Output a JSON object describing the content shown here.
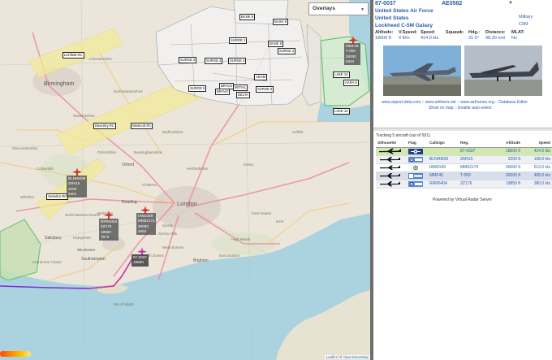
{
  "map": {
    "overlays_label": "Overlays",
    "attribution": {
      "leaflet": "Leaflet",
      "sep": "| ©",
      "osm": "OpenStreetMap"
    },
    "cities": {
      "birmingham": "Birmingham",
      "london": "London",
      "oxford": "Oxford",
      "southampton": "Southampton",
      "brighton": "Brighton",
      "salisbury": "Salisbury",
      "winchester": "Winchester",
      "reading": "Reading"
    },
    "region_labels": [
      "Cotswolds",
      "North Wessex Downs",
      "Chilterns",
      "Surrey Hills",
      "High Weald",
      "South Downs",
      "Kent Downs",
      "Cranborne Chase",
      "Isle of Wight",
      "Northamptonshire",
      "Leicestershire",
      "Warwickshire",
      "Bedfordshire",
      "Hertfordshire",
      "Essex",
      "Kent",
      "Hampshire",
      "Berkshire",
      "Wiltshire",
      "Gloucestershire",
      "Oxfordshire",
      "Buckinghamshire",
      "Suffolk",
      "East Sussex",
      "West Sussex",
      "Surrey"
    ],
    "airspace_labels": {
      "bank8a": "BANK 8",
      "bank8b": "BASH 8",
      "bank8c": "BANK 8",
      "surge1": "SURGE 1",
      "surge2": "SURGE 2",
      "surge2b": "SURGE 2",
      "surge3": "SURGE 3",
      "surge4": "SURGE 4",
      "surge5": "SURGE 5",
      "surge6": "SURGE 6",
      "bravo": "BRAVO",
      "bravo2": "BRAVO",
      "initial": "INITIAL",
      "delta": "DELTA",
      "adam": "ADAM",
      "lake12": "LAKE 12",
      "lake14": "LAKE 14",
      "aara9": "AARA 9",
      "lichfield": "Lichfield RC",
      "daventry": "Daventry RC",
      "westcott": "Westcott RC",
      "swindon": "Swindon RC"
    },
    "aircraft": [
      {
        "id": "BLNHM39",
        "lines": [
          "BLNHM39",
          "ZM415",
          "2200",
          "6401"
        ]
      },
      {
        "id": "RRR6404",
        "lines": [
          "RRR6404",
          "ZZ176",
          "18850",
          "7573"
        ]
      },
      {
        "id": "IAM3169",
        "lines": [
          "IAM3169",
          "MM62174",
          "36000",
          "2064"
        ]
      },
      {
        "id": "MMF45",
        "lines": [
          "MMF45",
          "T-059",
          "36000",
          "6344"
        ]
      },
      {
        "id": "87-0037",
        "lines": [
          "87-0037",
          "18600"
        ]
      }
    ]
  },
  "detail": {
    "registration": "87-0037",
    "icao": "AE0582",
    "operator": "United States Air Force",
    "country": "United States",
    "type": "Lockheed C-5M Galaxy",
    "category": "Military",
    "type_code": "C5M",
    "fields": [
      {
        "label": "Altitude:",
        "value": "18600 ft"
      },
      {
        "label": "V.Speed:",
        "value": "0 ft/m"
      },
      {
        "label": "Speed:",
        "value": "414.0 kts"
      },
      {
        "label": "Squawk:",
        "value": ""
      },
      {
        "label": "Hdg.:",
        "value": "31.0°"
      },
      {
        "label": "Distance:",
        "value": "98.30 nmi"
      },
      {
        "label": "MLAT:",
        "value": "No"
      }
    ],
    "links_line1": "www.airport-data.com :: www.airliners.net :: www.airframes.org :: Database Editor",
    "links_line2": "Show on map :: Enable auto-select"
  },
  "list": {
    "tracking_text": "Tracking 5 aircraft (out of 931).",
    "columns": [
      "Silhouette",
      "Flag",
      "Callsign",
      "Reg.",
      "Altitude",
      "Speed"
    ],
    "rows": [
      {
        "callsign": "",
        "reg": "87-0037",
        "altitude": "18600 ft",
        "speed": "414.0 kts",
        "flag": "usaf"
      },
      {
        "callsign": "BLNHM39",
        "reg": "ZM415",
        "altitude": "2200 ft",
        "speed": "108.0 kts",
        "flag": "raf"
      },
      {
        "callsign": "IAM3169",
        "reg": "MM62174",
        "altitude": "36000 ft",
        "speed": "513.0 kts",
        "flag": "ami"
      },
      {
        "callsign": "MMF45",
        "reg": "T-059",
        "altitude": "36000 ft",
        "speed": "408.0 kts",
        "flag": "mil"
      },
      {
        "callsign": "RRR6404",
        "reg": "ZZ176",
        "altitude": "19850 ft",
        "speed": "380.0 kts",
        "flag": "raf"
      }
    ],
    "powered_by": "Powered by Virtual Radar Server"
  },
  "colors": {
    "accent": "#2b5cac",
    "selected_row": "#cfe9ae",
    "aircraft_red": "#d6302b",
    "selected_aircraft": "#c23ab0",
    "track": "#5a2bd0"
  }
}
